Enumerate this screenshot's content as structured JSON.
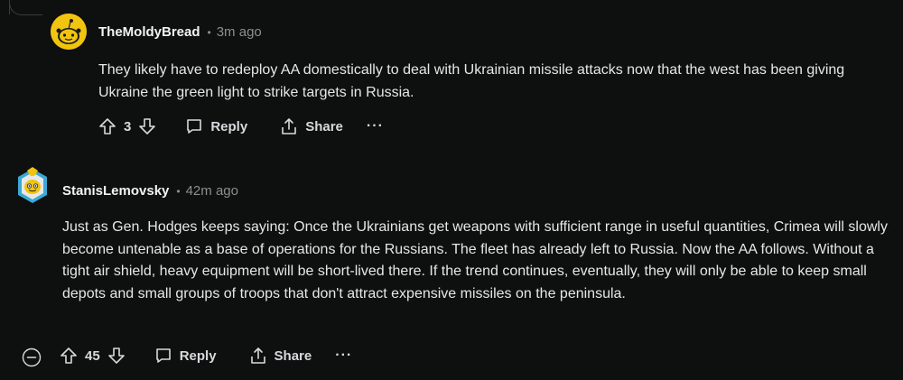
{
  "comments": [
    {
      "username": "TheMoldyBread",
      "separator": "•",
      "time": "3m ago",
      "body": "They likely have to redeploy AA domestically to deal with Ukrainian missile attacks now that the west has been giving Ukraine the green light to strike targets in Russia.",
      "score": "3",
      "reply_label": "Reply",
      "share_label": "Share",
      "more_label": "···"
    },
    {
      "username": "StanisLemovsky",
      "separator": "•",
      "time": "42m ago",
      "body": "Just as Gen. Hodges keeps saying: Once the Ukrainians get weapons with sufficient range in useful quantities, Crimea will slowly become untenable as a base of operations for the Russians. The fleet has already left to Russia. Now the AA follows. Without a tight air shield, heavy equipment will be short-lived there. If the trend continues, eventually, they will only be able to keep small depots and small groups of troops that don't attract expensive missiles on the peninsula.",
      "score": "45",
      "reply_label": "Reply",
      "share_label": "Share",
      "more_label": "···"
    }
  ],
  "icons": {
    "upvote": "arrow-up-icon",
    "downvote": "arrow-down-icon",
    "reply": "speech-bubble-icon",
    "share": "share-icon",
    "collapse": "minus-circle-icon"
  },
  "colors": {
    "background": "#0e0f0f",
    "text": "#d7dadc",
    "muted": "#8a8f91",
    "avatar_yellow": "#f1c40f"
  }
}
